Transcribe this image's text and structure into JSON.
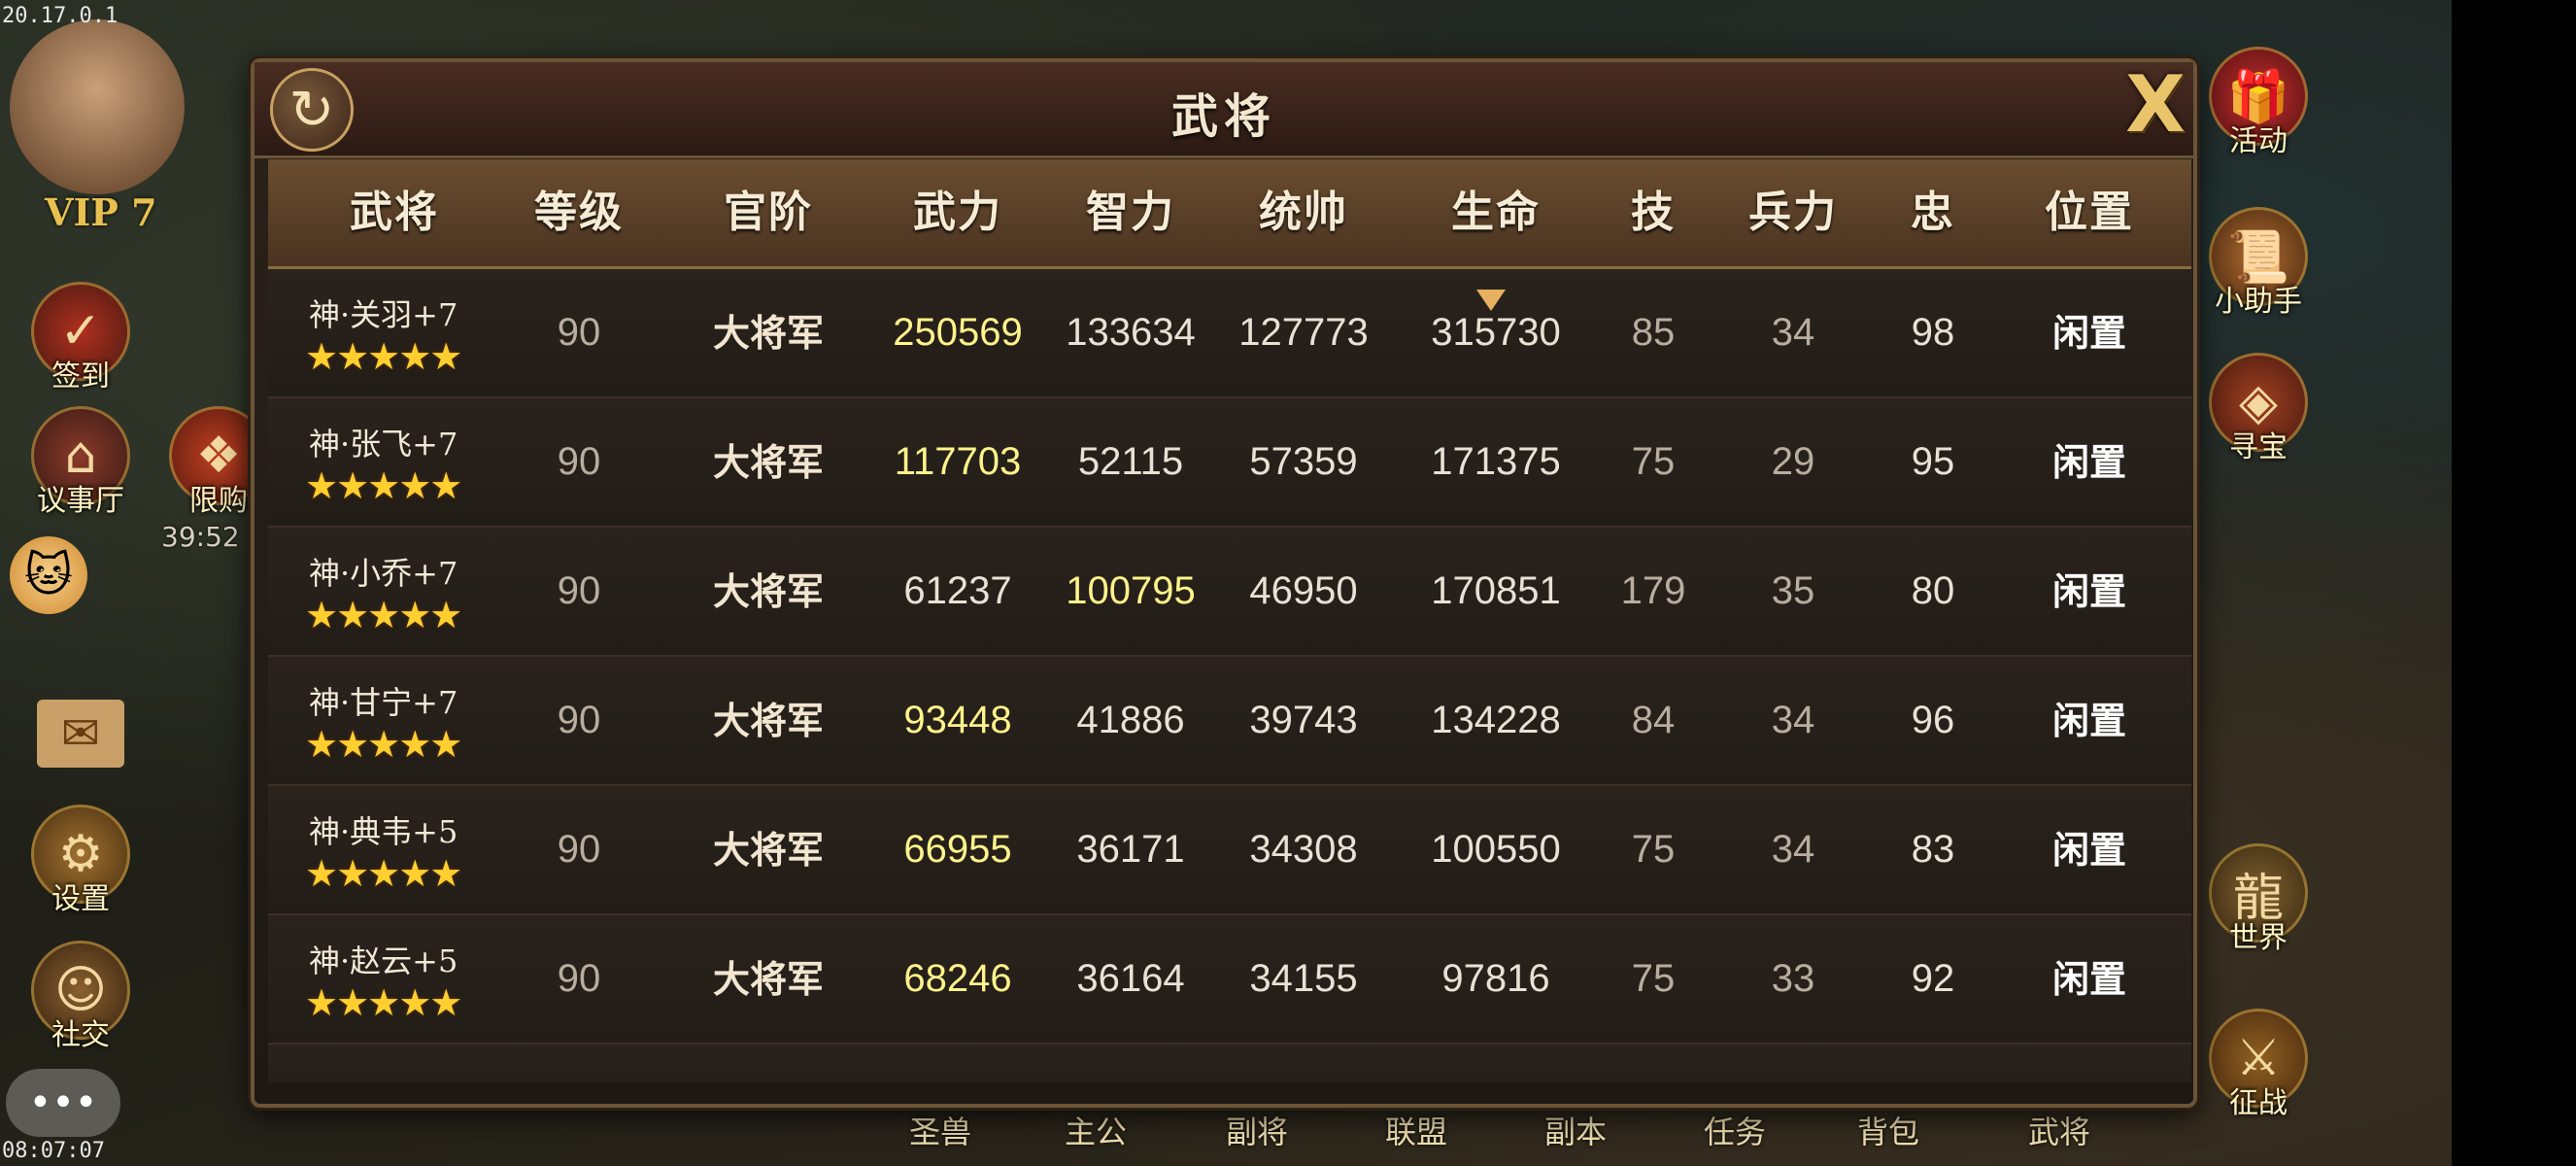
{
  "status": {
    "ip": "20.17.0.1",
    "clock": "08:07:07"
  },
  "hud": {
    "vip": "VIP 7",
    "timer": "39:52",
    "left_menu": [
      {
        "label": "签到",
        "icon": "sign-in-icon"
      },
      {
        "label": "议事厅",
        "icon": "council-hall-icon"
      },
      {
        "label": "限购",
        "icon": "limited-shop-icon"
      },
      {
        "label": "设置",
        "icon": "gear-icon"
      },
      {
        "label": "社交",
        "icon": "social-icon"
      }
    ],
    "right_menu": [
      {
        "label": "活动",
        "icon": "gift-icon"
      },
      {
        "label": "小助手",
        "icon": "scroll-icon"
      },
      {
        "label": "寻宝",
        "icon": "treasure-chest-icon"
      },
      {
        "label": "世界",
        "icon": "dragon-icon"
      },
      {
        "label": "征战",
        "icon": "battle-icon"
      }
    ],
    "bottom_tabs": [
      "圣兽",
      "主公",
      "副将",
      "联盟",
      "副本",
      "任务",
      "背包",
      "武将"
    ]
  },
  "dialog": {
    "title": "武将",
    "refresh_symbol": "↻",
    "close_symbol": "X",
    "columns": [
      "武将",
      "等级",
      "官阶",
      "武力",
      "智力",
      "统帅",
      "生命",
      "技",
      "兵力",
      "忠",
      "位置"
    ],
    "sorted_column": "生命",
    "rows": [
      {
        "name": "神·关羽+7",
        "stars": "★★★★★",
        "level": "90",
        "rank": "大将军",
        "force": "250569",
        "intel": "133634",
        "command": "127773",
        "hp": "315730",
        "skill": "85",
        "troops": "34",
        "loyalty": "98",
        "position": "闲置",
        "highlight": "force"
      },
      {
        "name": "神·张飞+7",
        "stars": "★★★★★",
        "level": "90",
        "rank": "大将军",
        "force": "117703",
        "intel": "52115",
        "command": "57359",
        "hp": "171375",
        "skill": "75",
        "troops": "29",
        "loyalty": "95",
        "position": "闲置",
        "highlight": "force"
      },
      {
        "name": "神·小乔+7",
        "stars": "★★★★★",
        "level": "90",
        "rank": "大将军",
        "force": "61237",
        "intel": "100795",
        "command": "46950",
        "hp": "170851",
        "skill": "179",
        "troops": "35",
        "loyalty": "80",
        "position": "闲置",
        "highlight": "intel"
      },
      {
        "name": "神·甘宁+7",
        "stars": "★★★★★",
        "level": "90",
        "rank": "大将军",
        "force": "93448",
        "intel": "41886",
        "command": "39743",
        "hp": "134228",
        "skill": "84",
        "troops": "34",
        "loyalty": "96",
        "position": "闲置",
        "highlight": "force"
      },
      {
        "name": "神·典韦+5",
        "stars": "★★★★★",
        "level": "90",
        "rank": "大将军",
        "force": "66955",
        "intel": "36171",
        "command": "34308",
        "hp": "100550",
        "skill": "75",
        "troops": "34",
        "loyalty": "83",
        "position": "闲置",
        "highlight": "force"
      },
      {
        "name": "神·赵云+5",
        "stars": "★★★★★",
        "level": "90",
        "rank": "大将军",
        "force": "68246",
        "intel": "36164",
        "command": "34155",
        "hp": "97816",
        "skill": "75",
        "troops": "33",
        "loyalty": "92",
        "position": "闲置",
        "highlight": "force"
      }
    ]
  },
  "colors": {
    "highlight": "#fff38a",
    "stars": "#ffcf30",
    "header_bg": "#6a4d30"
  }
}
